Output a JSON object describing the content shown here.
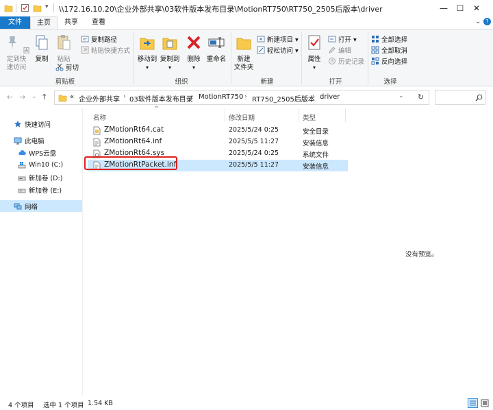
{
  "window": {
    "title": "\\\\172.16.10.20\\企业外部共享\\03软件版本发布目录\\MotionRT750\\RT750_2505后版本\\driver",
    "minimize": "—",
    "maximize": "☐",
    "close": "✕"
  },
  "tabs": {
    "file": "文件",
    "home": "主页",
    "share": "共享",
    "view": "查看"
  },
  "ribbon": {
    "clipboard": {
      "pin": "固定到快\n速访问",
      "copy": "复制",
      "paste": "粘贴",
      "copy_path": "复制路径",
      "paste_shortcut": "粘贴快捷方式",
      "cut": "剪切",
      "label": "剪贴板"
    },
    "organize": {
      "move_to": "移动到",
      "copy_to": "复制到",
      "delete": "删除",
      "rename": "重命名",
      "label": "组织"
    },
    "new": {
      "new_folder": "新建\n文件夹",
      "new_item": "新建项目 ▾",
      "easy_access": "轻松访问 ▾",
      "label": "新建"
    },
    "open": {
      "properties": "属性",
      "open": "打开 ▾",
      "edit": "编辑",
      "history": "历史记录",
      "label": "打开"
    },
    "select": {
      "select_all": "全部选择",
      "select_none": "全部取消",
      "invert": "反向选择",
      "label": "选择"
    }
  },
  "address": {
    "crumbs": [
      "«",
      "企业外部共享",
      "03软件版本发布目录",
      "MotionRT750",
      "RT750_2505后版本",
      "driver"
    ]
  },
  "nav": {
    "quick_access": "快速访问",
    "this_pc": "此电脑",
    "wps": "WPS云盘",
    "c": "Win10 (C:)",
    "d": "新加卷 (D:)",
    "e": "新加卷 (E:)",
    "network": "网络"
  },
  "columns": {
    "name": "名称",
    "date": "修改日期",
    "type": "类型"
  },
  "files": [
    {
      "name": "ZMotionRt64.cat",
      "date": "2025/5/24 0:25",
      "type": "安全目录"
    },
    {
      "name": "ZMotionRt64.inf",
      "date": "2025/5/5 11:27",
      "type": "安装信息"
    },
    {
      "name": "ZMotionRt64.sys",
      "date": "2025/5/24 0:25",
      "type": "系统文件"
    },
    {
      "name": "ZMotionRtPacket.inf",
      "date": "2025/5/5 11:27",
      "type": "安装信息"
    }
  ],
  "preview": {
    "empty": "没有预览。"
  },
  "status": {
    "count": "4 个项目",
    "selected": "选中 1 个项目",
    "size": "1.54 KB"
  },
  "colors": {
    "file_tab": "#1979ca",
    "selection": "#cce8ff",
    "highlight_box": "#e02020"
  }
}
